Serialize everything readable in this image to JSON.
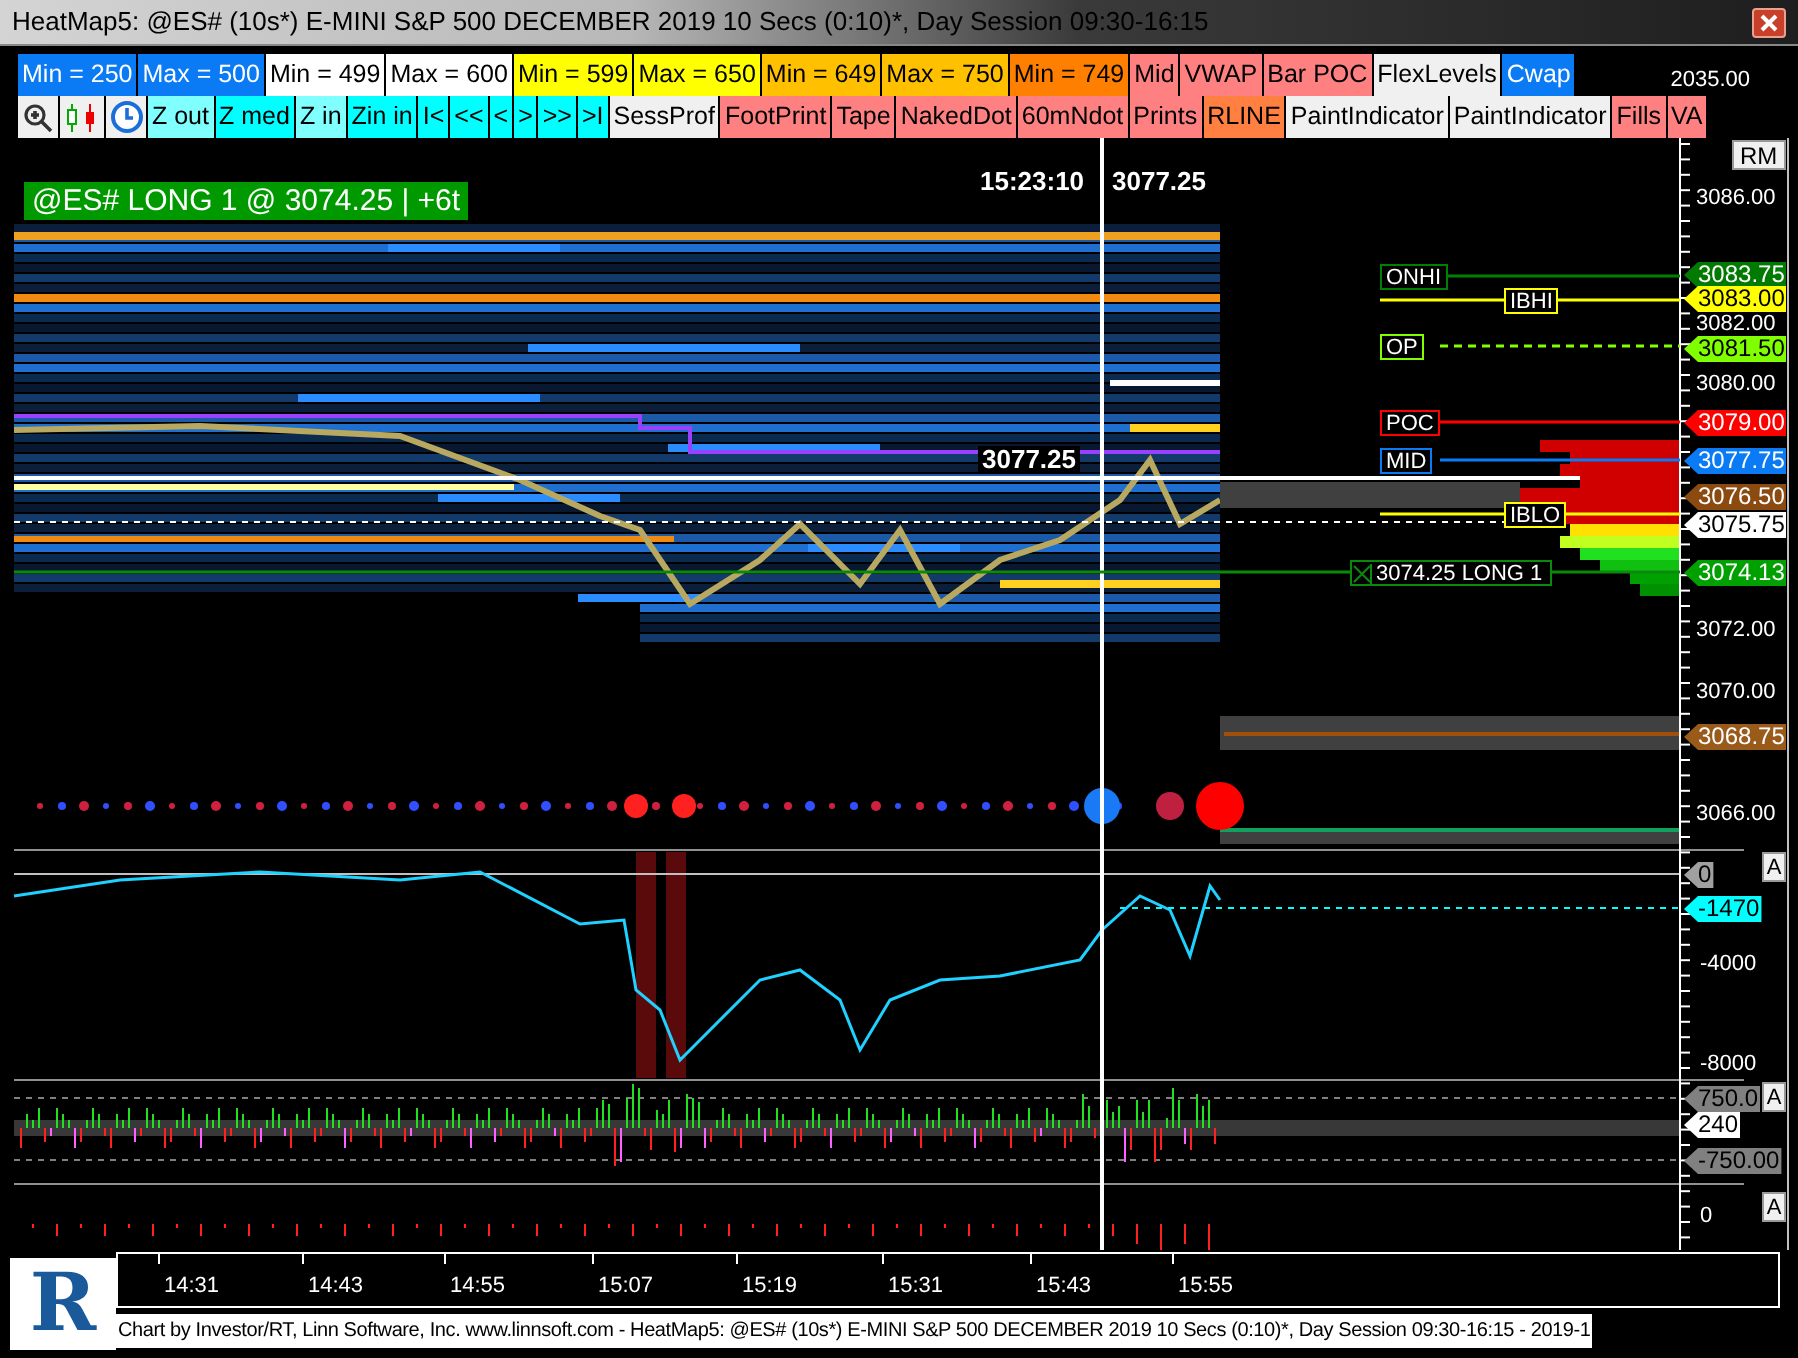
{
  "window": {
    "title": "HeatMap5: @ES# (10s*) E-MINI S&P 500 DECEMBER 2019 10 Secs (0:10)*, Day Session 09:30-16:15"
  },
  "toolbar": {
    "filter_buttons": [
      {
        "label": "Min = 250",
        "color": "#0a7af5"
      },
      {
        "label": "Max = 500",
        "color": "#0a7af5"
      },
      {
        "label": "Min = 499",
        "color": "#ffffff"
      },
      {
        "label": "Max = 600",
        "color": "#ffffff"
      },
      {
        "label": "Min = 599",
        "color": "#ffff00"
      },
      {
        "label": "Max = 650",
        "color": "#ffff00"
      },
      {
        "label": "Min = 649",
        "color": "#ffc000"
      },
      {
        "label": "Max = 750",
        "color": "#ffc000"
      },
      {
        "label": "Min = 749",
        "color": "#ff8000"
      },
      {
        "label": "Mid",
        "color": "#ff8080"
      },
      {
        "label": "VWAP",
        "color": "#ff8080"
      },
      {
        "label": "Bar POC",
        "color": "#ff8080"
      },
      {
        "label": "FlexLevels",
        "color": "#f0f0f0"
      },
      {
        "label": "Cwap",
        "color": "#0a7af5"
      }
    ],
    "tool_buttons": [
      {
        "label": "Z out",
        "color": "#80ffff"
      },
      {
        "label": "Z med",
        "color": "#00ffff"
      },
      {
        "label": "Z in",
        "color": "#80ffff"
      },
      {
        "label": "Zin in",
        "color": "#00ffff"
      },
      {
        "label": "I<",
        "color": "#00ffff"
      },
      {
        "label": "<<",
        "color": "#00ffff"
      },
      {
        "label": "<",
        "color": "#00ffff"
      },
      {
        "label": ">",
        "color": "#00ffff"
      },
      {
        "label": ">>",
        "color": "#00ffff"
      },
      {
        "label": ">I",
        "color": "#00ffff"
      },
      {
        "label": "SessProf",
        "color": "#f0f0f0"
      },
      {
        "label": "FootPrint",
        "color": "#ff8080"
      },
      {
        "label": "Tape",
        "color": "#ff8080"
      },
      {
        "label": "NakedDot",
        "color": "#ff8080"
      },
      {
        "label": "60mNdot",
        "color": "#ff8080"
      },
      {
        "label": "Prints",
        "color": "#ff8080"
      },
      {
        "label": "RLINE",
        "color": "#ff8040"
      },
      {
        "label": "PaintIndicator",
        "color": "#f0f0f0"
      },
      {
        "label": "PaintIndicator",
        "color": "#f0f0f0"
      },
      {
        "label": "Fills",
        "color": "#ff8080"
      },
      {
        "label": "VA",
        "color": "#ff8080"
      }
    ]
  },
  "chart": {
    "top_axis_label": "2035.00",
    "rm_button": "RM",
    "banner": "@ES# LONG 1 @ 3074.25 | +6t",
    "cursor_time": "15:23:10",
    "cursor_price": "3077.25",
    "last_price_label": "3077.25",
    "axis_labels": [
      "3086.00",
      "3082.00",
      "3080.00",
      "3072.00",
      "3070.00",
      "3066.00"
    ],
    "level_markers": [
      {
        "label": "ONHI",
        "color": "#008000"
      },
      {
        "label": "IBHI",
        "color": "#ffff00"
      },
      {
        "label": "OP",
        "color": "#80ff00"
      },
      {
        "label": "POC",
        "color": "#ff0000"
      },
      {
        "label": "MID",
        "color": "#0a7af5"
      },
      {
        "label": "IBLO",
        "color": "#ffff00"
      }
    ],
    "position_marker": "3074.25 LONG 1",
    "price_tags": [
      {
        "label": "3083.75",
        "color": "#007a00"
      },
      {
        "label": "3083.00",
        "color": "#ffff00"
      },
      {
        "label": "3081.50",
        "color": "#80ff00"
      },
      {
        "label": "3079.00",
        "color": "#ff0000"
      },
      {
        "label": "3077.75",
        "color": "#0a7af5"
      },
      {
        "label": "3076.50",
        "color": "#8b4a10"
      },
      {
        "label": "3075.75",
        "color": "#ffffff"
      },
      {
        "label": "3074.13",
        "color": "#00a000"
      },
      {
        "label": "3068.75",
        "color": "#9a5a1a"
      }
    ],
    "panels": [
      {
        "scale_button": "A",
        "axis_labels": [
          "-4000",
          "-8000"
        ],
        "tags": [
          {
            "label": "0",
            "color": "#a0a0a0"
          },
          {
            "label": "-1470",
            "color": "#00ffff"
          }
        ]
      },
      {
        "scale_button": "A",
        "tags": [
          {
            "label": "750.0",
            "color": "#808080"
          },
          {
            "label": "240",
            "color": "#ffffff"
          },
          {
            "label": "-750.00",
            "color": "#808080"
          }
        ]
      },
      {
        "scale_button": "A",
        "axis_labels": [
          "0"
        ]
      }
    ],
    "time_axis": [
      "14:31",
      "14:43",
      "14:55",
      "15:07",
      "15:19",
      "15:31",
      "15:43",
      "15:55"
    ]
  },
  "logo": {
    "text": "R"
  },
  "footer": "Chart by Investor/RT, Linn Software, Inc. www.linnsoft.com - HeatMap5: @ES# (10s*) E-MINI S&P 500 DECEMBER 2019 10 Secs (0:10)*, Day Session 09:30-16:15 - 2019-1"
}
